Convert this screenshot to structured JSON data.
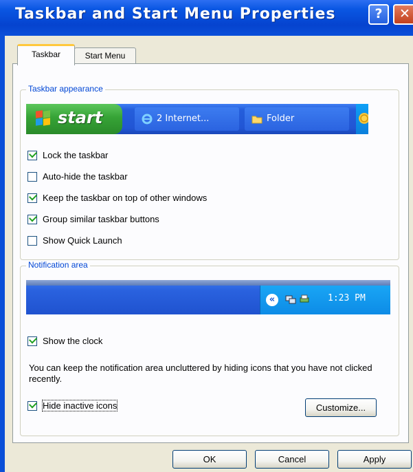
{
  "window": {
    "title": "Taskbar and Start Menu Properties",
    "help_label": "?",
    "close_label": "✕"
  },
  "tabs": [
    {
      "label": "Taskbar",
      "active": true
    },
    {
      "label": "Start Menu",
      "active": false
    }
  ],
  "taskbar_appearance": {
    "legend": "Taskbar appearance",
    "preview": {
      "start_label": "start",
      "task1": "2 Internet...",
      "task2": "Folder"
    },
    "options": [
      {
        "label": "Lock the taskbar",
        "checked": true
      },
      {
        "label": "Auto-hide the taskbar",
        "checked": false
      },
      {
        "label": "Keep the taskbar on top of other windows",
        "checked": true
      },
      {
        "label": "Group similar taskbar buttons",
        "checked": true
      },
      {
        "label": "Show Quick Launch",
        "checked": false
      }
    ]
  },
  "notification_area": {
    "legend": "Notification area",
    "clock_time": "1:23 PM",
    "chevron": "«",
    "show_clock": {
      "label": "Show the clock",
      "checked": true
    },
    "description": "You can keep the notification area uncluttered by hiding icons that you have not clicked recently.",
    "hide_inactive": {
      "label": "Hide inactive icons",
      "checked": true
    },
    "customize_label": "Customize..."
  },
  "buttons": {
    "ok": "OK",
    "cancel": "Cancel",
    "apply": "Apply"
  },
  "colors": {
    "title_bar": "#0a57e3",
    "dialog_bg": "#ece9d8",
    "legend_text": "#0046d5",
    "start_green": "#36a336",
    "tray_blue": "#0d8be6"
  }
}
